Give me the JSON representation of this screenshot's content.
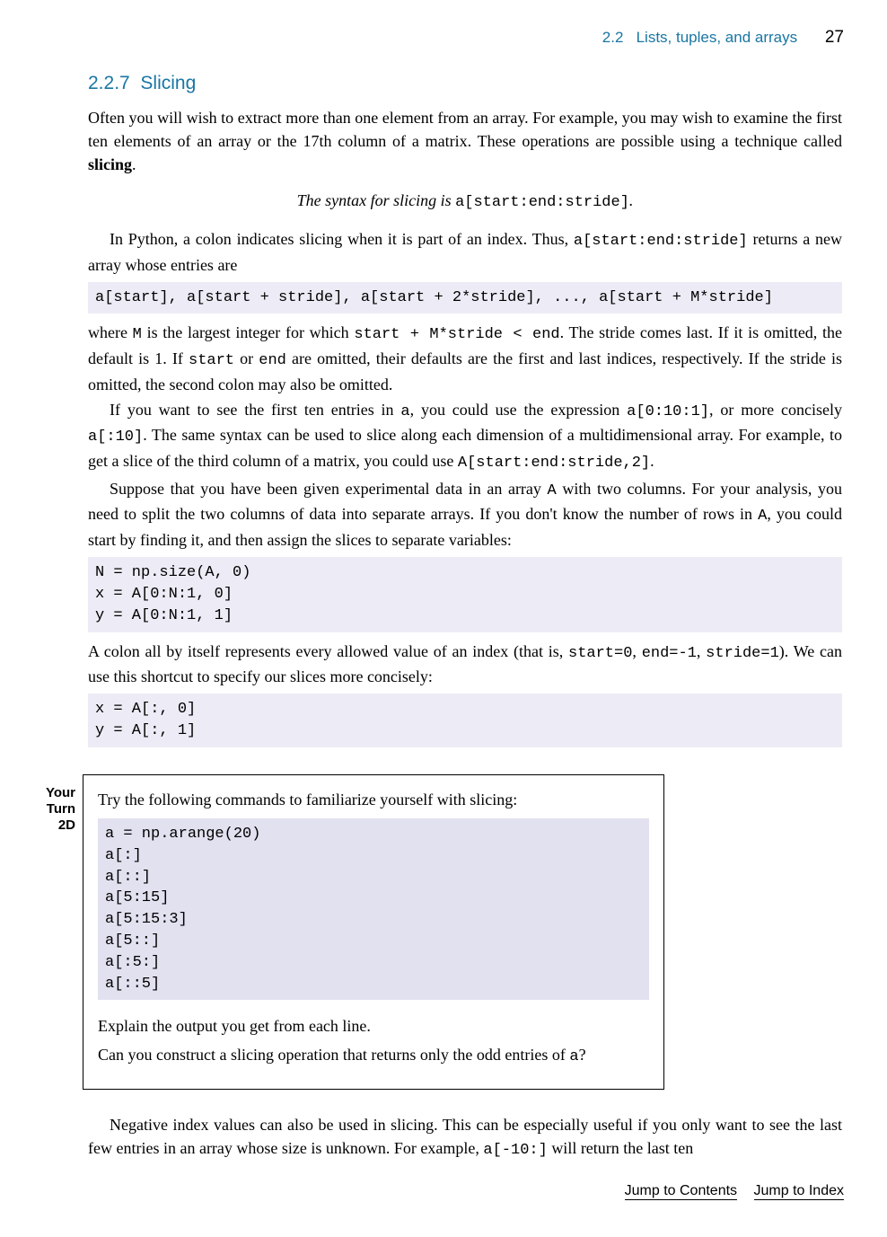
{
  "header": {
    "section_num": "2.2",
    "section_title": "Lists, tuples, and arrays",
    "page": "27"
  },
  "subsection": {
    "num": "2.2.7",
    "title": "Slicing"
  },
  "p1a": "Often you will wish to extract more than one element from an array. For example, you may wish to examine the first ten elements of an array or the 17th column of a matrix. These operations are possible using a technique called ",
  "p1b": "slicing",
  "p1c": ".",
  "syntax_a": "The syntax for slicing is ",
  "syntax_b": "a[start:end:stride]",
  "syntax_c": ".",
  "p2a": "In Python, a colon indicates slicing when it is part of an index. Thus, ",
  "p2b": "a[start:end:stride]",
  "p2c": " returns a new array whose entries are",
  "code1": "a[start], a[start + stride], a[start + 2*stride], ..., a[start + M*stride]",
  "p3a": "where ",
  "p3b": "M",
  "p3c": " is the largest integer for which ",
  "p3d": "start + M*stride < end",
  "p3e": ". The stride comes last. If it is omitted, the default is 1. If ",
  "p3f": "start",
  "p3g": " or ",
  "p3h": "end",
  "p3i": " are omitted, their defaults are the first and last indices, respectively. If the stride is omitted, the second colon may also be omitted.",
  "p4a": "If you want to see the first ten entries in ",
  "p4b": "a",
  "p4c": ", you could use the expression ",
  "p4d": "a[0:10:1]",
  "p4e": ", or more concisely ",
  "p4f": "a[:10]",
  "p4g": ". The same syntax can be used to slice along each dimension of a multidimensional array. For example, to get a slice of the third column of a matrix, you could use ",
  "p4h": "A[start:end:stride,2]",
  "p4i": ".",
  "p5a": "Suppose that you have been given experimental data in an array ",
  "p5b": "A",
  "p5c": " with two columns. For your analysis, you need to split the two columns of data into separate arrays. If you don't know the number of rows in ",
  "p5d": "A",
  "p5e": ", you could start by finding it, and then assign the slices to separate variables:",
  "code2": "N = np.size(A, 0)\nx = A[0:N:1, 0]\ny = A[0:N:1, 1]",
  "p6a": "A colon all by itself represents every allowed value of an index (that is, ",
  "p6b": "start=0",
  "p6c": ", ",
  "p6d": "end=-1",
  "p6e": ", ",
  "p6f": "stride=1",
  "p6g": "). We can use this shortcut to specify our slices more concisely:",
  "code3": "x = A[:, 0]\ny = A[:, 1]",
  "yourturn": {
    "label1": "Your",
    "label2": "Turn",
    "label3": "2D",
    "intro": "Try the following commands to familiarize yourself with slicing:",
    "code": "a = np.arange(20)\na[:]\na[::]\na[5:15]\na[5:15:3]\na[5::]\na[:5:]\na[::5]",
    "q1": "Explain the output you get from each line.",
    "q2a": "Can you construct a slicing operation that returns only the odd entries of ",
    "q2b": "a",
    "q2c": "?"
  },
  "p7a": "Negative index values can also be used in slicing. This can be especially useful if you only want to see the last few entries in an array whose size is unknown. For example, ",
  "p7b": "a[-10:]",
  "p7c": " will return the last ten",
  "footer": {
    "link1": "Jump to Contents",
    "link2": "Jump to Index"
  }
}
